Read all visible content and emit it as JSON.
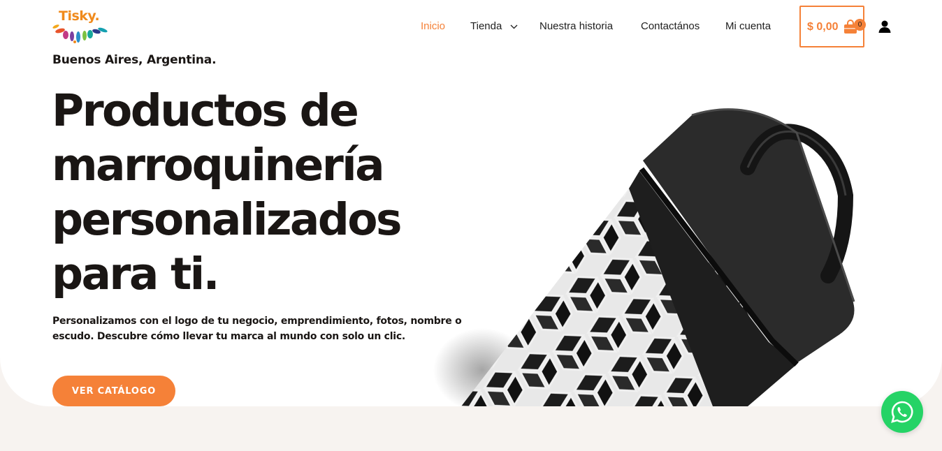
{
  "brand": {
    "name": "Tisky.",
    "colors": {
      "accent": "#f58138",
      "logo": "#f08a1c",
      "whatsapp": "#25d366"
    }
  },
  "nav": {
    "items": [
      {
        "label": "Inicio",
        "active": true
      },
      {
        "label": "Tienda",
        "has_dropdown": true
      },
      {
        "label": "Nuestra historia"
      },
      {
        "label": "Contactános"
      },
      {
        "label": "Mi cuenta"
      }
    ]
  },
  "cart": {
    "amount": "$ 0,00",
    "count": "0",
    "icon": "shopping-bag-icon"
  },
  "account": {
    "icon": "user-icon"
  },
  "hero": {
    "location": "Buenos Aires, Argentina.",
    "headline": [
      "Productos de",
      "marroquinería",
      "personalizados",
      "para ti."
    ],
    "subtext": [
      "Personalizamos con el logo de tu negocio, emprendimiento, fotos, nombre o",
      "escudo. Descubre cómo llevar tu marca al mundo con solo un clic."
    ],
    "cta_label": "VER CATÁLOGO"
  },
  "whatsapp": {
    "icon": "whatsapp-icon"
  }
}
